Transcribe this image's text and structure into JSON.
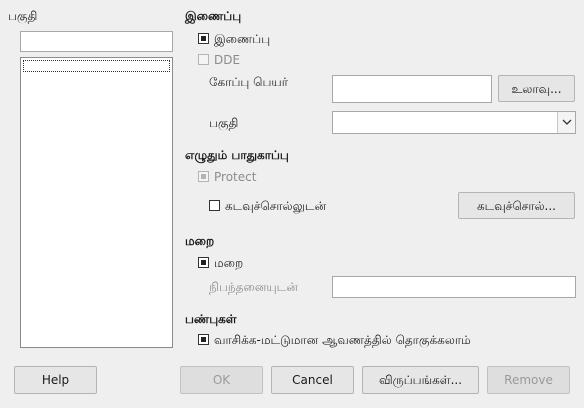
{
  "left": {
    "heading": "பகுதி",
    "filter_value": "",
    "list_items": []
  },
  "link": {
    "heading": "இணைப்பு",
    "link_checkbox_label": "இணைப்பு",
    "link_checked": true,
    "dde_label": "DDE",
    "dde_checked": false,
    "filename_label": "கோப்பு பெயர்",
    "filename_value": "",
    "browse_button": "உலாவு...",
    "section_label": "பகுதி",
    "section_value": ""
  },
  "write_protection": {
    "heading": "எழுதும் பாதுகாப்பு",
    "protect_label": "Protect",
    "protect_checked": true,
    "with_password_label": "கடவுச்சொல்லுடன்",
    "with_password_checked": false,
    "password_button": "கடவுச்சொல்..."
  },
  "hide": {
    "heading": "மறை",
    "hide_checkbox_label": "மறை",
    "hide_checked": true,
    "condition_label": "நிபந்தனையுடன்",
    "condition_value": ""
  },
  "properties": {
    "heading": "பண்புகள்",
    "editable_readonly_label": "வாசிக்க-மட்டுமான ஆவணத்தில் தொகுக்கலாம்",
    "editable_readonly_checked": true
  },
  "buttons": {
    "help": "Help",
    "ok": "OK",
    "cancel": "Cancel",
    "options": "விருப்பங்கள்...",
    "remove": "Remove"
  },
  "colors": {
    "background": "#efefef",
    "field": "#ffffff",
    "disabled_text": "#8c8c8c"
  }
}
